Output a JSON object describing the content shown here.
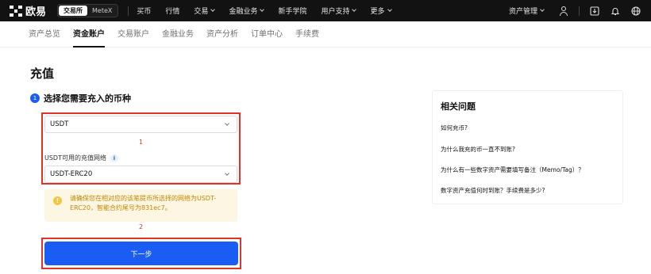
{
  "topnav": {
    "logo_text": "欧易",
    "switch": [
      "交易所",
      "MeteX"
    ],
    "items": [
      {
        "label": "买币",
        "has_menu": false
      },
      {
        "label": "行情",
        "has_menu": false
      },
      {
        "label": "交易",
        "has_menu": true
      },
      {
        "label": "金融业务",
        "has_menu": true
      },
      {
        "label": "新手学院",
        "has_menu": false
      },
      {
        "label": "用户支持",
        "has_menu": true
      },
      {
        "label": "更多",
        "has_menu": true
      }
    ],
    "asset_label": "资产管理",
    "icons": [
      "user-icon",
      "download-icon",
      "bell-icon",
      "globe-icon"
    ]
  },
  "subnav": {
    "tabs": [
      "资产总览",
      "资金账户",
      "交易账户",
      "金融业务",
      "资产分析",
      "订单中心",
      "手续费"
    ],
    "active": "资金账户"
  },
  "page": {
    "title": "充值",
    "step_num": "1",
    "step_text": "选择您需要充入的币种",
    "coin_value": "USDT",
    "network_label": "USDT可用的充值网络",
    "network_info_icon": "i",
    "network_value": "USDT-ERC20",
    "notice_text": "请确保您在相对应的该笔提币所选择的网络为USDT-ERC20，智能合约尾号为831ec7。",
    "notice_icon": "!",
    "next_label": "下一步",
    "annotations": [
      "1",
      "2"
    ],
    "annotation_color": "#e0342b",
    "accent_color": "#1b5cf2"
  },
  "faq": {
    "title": "相关问题",
    "items": [
      "如何充币?",
      "为什么我充的币一直不到账?",
      "为什么有一些数字资产需要填写备注（Memo/Tag）？",
      "数字资产充值何时到账？手续费是多少?"
    ]
  }
}
